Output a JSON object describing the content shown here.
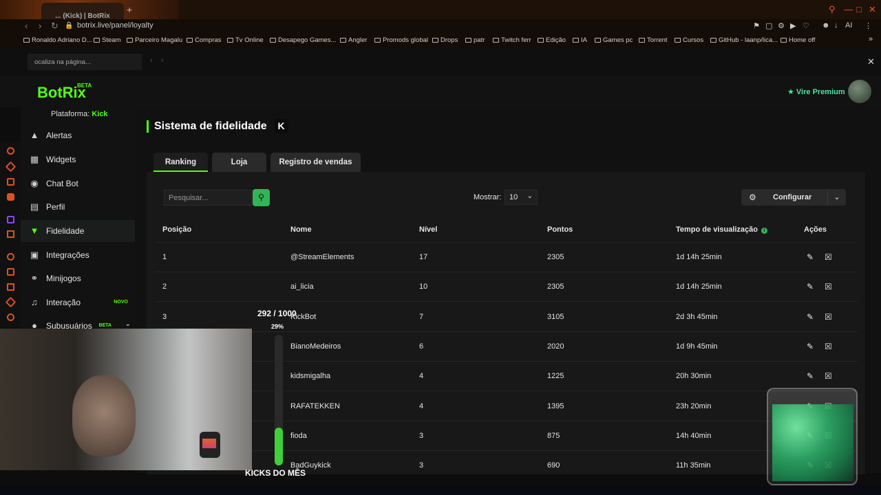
{
  "browser": {
    "tab_title": "... (Kick) | BotRix",
    "url": "botrix.live/panel/loyalty",
    "find_placeholder": "ocaliza na página...",
    "bookmarks": [
      "Ronaldo Adriano D...",
      "Steam",
      "Parceiro Magalu",
      "Compras",
      "Tv Online",
      "Desapego Games...",
      "Angler",
      "Promods global",
      "Drops",
      "patr",
      "Twitch ferr",
      "Edição",
      "IA",
      "Games pc",
      "Torrent",
      "Cursos",
      "GitHub - laanp/lica...",
      "Home off"
    ]
  },
  "app": {
    "logo": "BotRix",
    "beta": "BETA",
    "premium": "Vire Premium"
  },
  "sidebar": {
    "platform_label": "Plataforma:",
    "platform_value": "Kick",
    "items": [
      {
        "label": "Alertas",
        "icon": "alert-icon"
      },
      {
        "label": "Widgets",
        "icon": "widgets-icon"
      },
      {
        "label": "Chat Bot",
        "icon": "bot-icon"
      },
      {
        "label": "Perfil",
        "icon": "profile-icon"
      },
      {
        "label": "Fidelidade",
        "icon": "trophy-icon"
      },
      {
        "label": "Integrações",
        "icon": "integration-icon"
      },
      {
        "label": "Minijogos",
        "icon": "gamepad-icon"
      },
      {
        "label": "Interação",
        "icon": "music-icon",
        "badge": "NOVO"
      },
      {
        "label": "Subusuários",
        "icon": "users-icon",
        "badge": "BETA"
      }
    ]
  },
  "page": {
    "title": "Sistema de fidelidade",
    "platform_badge": "K",
    "tabs": [
      "Ranking",
      "Loja",
      "Registro de vendas"
    ],
    "search_placeholder": "Pesquisar...",
    "show_label": "Mostrar:",
    "show_value": "10",
    "configure": "Configurar"
  },
  "table": {
    "headers": [
      "Posição",
      "Nome",
      "Nível",
      "Pontos",
      "Tempo de visualização",
      "Ações"
    ],
    "rows": [
      [
        "1",
        "@StreamElements",
        "17",
        "2305",
        "1d 14h 25min"
      ],
      [
        "2",
        "ai_licia",
        "10",
        "2305",
        "1d 14h 25min"
      ],
      [
        "3",
        "KickBot",
        "7",
        "3105",
        "2d 3h 45min"
      ],
      [
        "",
        "BianoMedeiros",
        "6",
        "2020",
        "1d 9h 45min"
      ],
      [
        "",
        "kidsmigalha",
        "4",
        "1225",
        "20h 30min"
      ],
      [
        "",
        "RAFATEKKEN",
        "4",
        "1395",
        "23h 20min"
      ],
      [
        "",
        "fioda",
        "3",
        "875",
        "14h 40min"
      ],
      [
        "",
        "BadGuykick",
        "3",
        "690",
        "11h 35min"
      ]
    ]
  },
  "overlay": {
    "goal_count": "292 / 1000",
    "goal_percent": "29%",
    "goal_fraction": 0.29,
    "goal_label": "KICKS DO MÊS"
  },
  "colors": {
    "accent": "#53fc18",
    "button_green": "#32b557",
    "panel": "#181818"
  }
}
